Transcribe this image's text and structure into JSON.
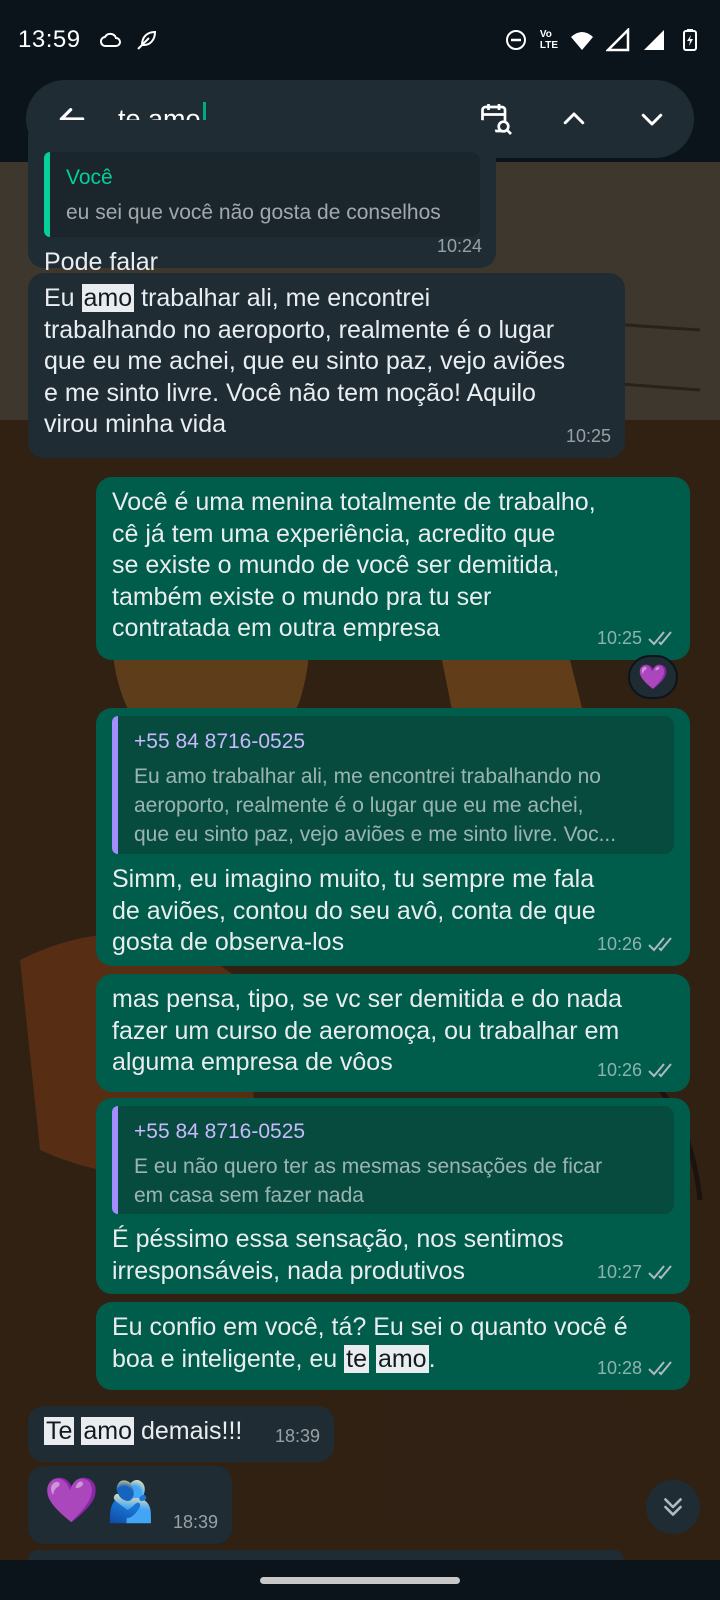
{
  "status_bar": {
    "time": "13:59",
    "left_icons": [
      "cloud-icon",
      "feather-icon"
    ],
    "right_icons": [
      "dnd-icon",
      "volte-icon",
      "wifi-icon",
      "signal-icon",
      "signal-icon",
      "battery-icon"
    ],
    "volte_label_top": "Vo",
    "volte_label_bottom": "LTE"
  },
  "search": {
    "query": "te amo",
    "icons": [
      "back-arrow-icon",
      "calendar-search-icon",
      "chevron-up-icon",
      "chevron-down-icon"
    ]
  },
  "messages": [
    {
      "id": "m1",
      "direction": "in",
      "quote_author": "Você",
      "quote_text": "eu sei que você não gosta de conselhos",
      "text": "Pode falar",
      "time": "10:24"
    },
    {
      "id": "m2",
      "direction": "in",
      "lines": [
        "Eu amo trabalhar ali, me encontrei",
        "trabalhando no aeroporto, realmente é o lugar",
        "que eu me achei, que eu sinto paz, vejo aviões",
        "e me sinto livre. Você não tem noção! Aquilo",
        "virou minha vida"
      ],
      "highlight": "amo",
      "time": "10:25"
    },
    {
      "id": "m3",
      "direction": "out",
      "lines": [
        "Você é uma menina totalmente de trabalho,",
        "cê já tem uma experiência, acredito que",
        "se existe o mundo de você ser demitida,",
        "também existe o mundo pra tu ser",
        "contratada em outra empresa"
      ],
      "time": "10:25",
      "reaction": "💜"
    },
    {
      "id": "m4",
      "direction": "out",
      "quote_author": "+55 84 8716-0525",
      "quote_lines": [
        "Eu amo trabalhar ali, me encontrei trabalhando no",
        "aeroporto, realmente é o lugar que eu me achei,",
        "que eu sinto paz, vejo aviões e me sinto livre. Voc..."
      ],
      "lines": [
        "Simm, eu imagino muito, tu sempre me fala",
        "de aviões, contou do seu avô, conta de que",
        "gosta de observa-los"
      ],
      "time": "10:26"
    },
    {
      "id": "m5",
      "direction": "out",
      "lines": [
        "mas pensa, tipo, se vc ser demitida e do nada",
        "fazer um curso de aeromoça, ou trabalhar em",
        "alguma empresa de vôos"
      ],
      "time": "10:26"
    },
    {
      "id": "m6",
      "direction": "out",
      "quote_author": "+55 84 8716-0525",
      "quote_lines": [
        "E eu não quero ter as mesmas sensações de ficar",
        "em casa sem fazer nada"
      ],
      "lines": [
        "É péssimo essa sensação, nos sentimos",
        "irresponsáveis, nada produtivos"
      ],
      "time": "10:27"
    },
    {
      "id": "m7",
      "direction": "out",
      "line1": "Eu confio em você, tá? Eu sei o quanto você é",
      "line2_pre": "boa e inteligente, eu ",
      "line2_hl1": "te",
      "line2_hl2": "amo",
      "line2_post": ".",
      "time": "10:28"
    },
    {
      "id": "m8",
      "direction": "in",
      "hl1": "Te",
      "hl2": "amo",
      "post": " demais!!!",
      "time": "18:39"
    },
    {
      "id": "m9",
      "direction": "in",
      "emoji1": "💜",
      "emoji2": "🫂",
      "time": "18:39"
    }
  ],
  "colors": {
    "incoming_bubble": "#1f2c34",
    "outgoing_bubble": "#005c4b",
    "header": "#0b141a",
    "accent": "#00a884"
  }
}
